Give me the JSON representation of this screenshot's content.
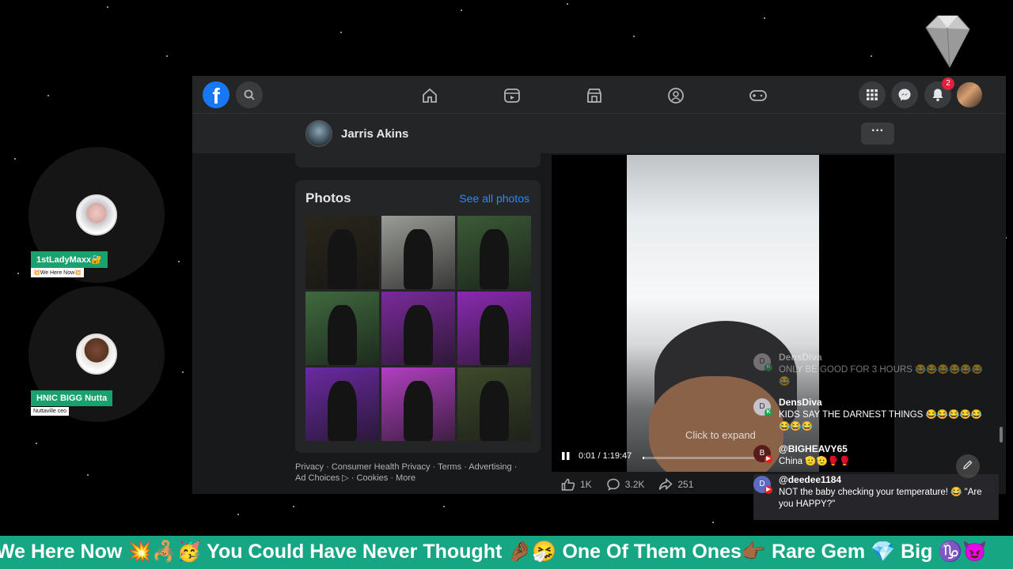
{
  "guests": [
    {
      "name": "1stLadyMaxx🔐",
      "subtitle": "💥We Here Now💥"
    },
    {
      "name": "HNIC BIGG Nutta",
      "subtitle": "Nuttaville ceo"
    }
  ],
  "facebook": {
    "logo": "f",
    "notification_count": "2",
    "nav_icons": [
      "home-icon",
      "watch-icon",
      "marketplace-icon",
      "groups-icon",
      "gaming-icon"
    ],
    "post_author": "Jarris Akins",
    "more_label": "···",
    "photos": {
      "title": "Photos",
      "see_all": "See all photos",
      "tile_colors": [
        "#2a261c",
        "#9a9c96",
        "#3b5a36",
        "#3f6a3e",
        "#7a2a9a",
        "#8a2ab0",
        "#6a2aa0",
        "#b040c0",
        "#3e4a2c"
      ]
    },
    "footer_links": {
      "line1": "Privacy · Consumer Health Privacy · Terms · Advertising ·",
      "line2": "Ad Choices ▷ · Cookies · More"
    },
    "video": {
      "click_to_expand": "Click to expand",
      "time": "0:01 / 1:19:47"
    },
    "reactions": {
      "likes": "1K",
      "comments": "3.2K",
      "shares": "251"
    }
  },
  "chat": [
    {
      "avatar": "D",
      "name": "DensDiva",
      "text": "ONLY BE GOOD FOR 3 HOURS 😂😂😂😂😂😂😂"
    },
    {
      "avatar": "D",
      "name": "DensDiva",
      "text": "KIDS SAY THE DARNEST THINGS 😂😂😂😂😂😂😂😂"
    },
    {
      "avatar": "B",
      "name": "@BIGHEAVY65",
      "text": "China 🫡🫡🥊🥊"
    },
    {
      "avatar": "D",
      "name": "@deedee1184",
      "text": "NOT the baby checking your temperature! 😂 \"Are you HAPPY?\""
    }
  ],
  "ticker": {
    "text": "We Here Now 💥🦂🥳 You Could Have Never Thought 🤌🏾🤧 One Of Them Ones👉🏾 Rare Gem 💎 Big ♑😈"
  },
  "colors": {
    "accent": "#17a683",
    "fb_blue": "#1877f2",
    "fb_bg": "#18191a"
  }
}
